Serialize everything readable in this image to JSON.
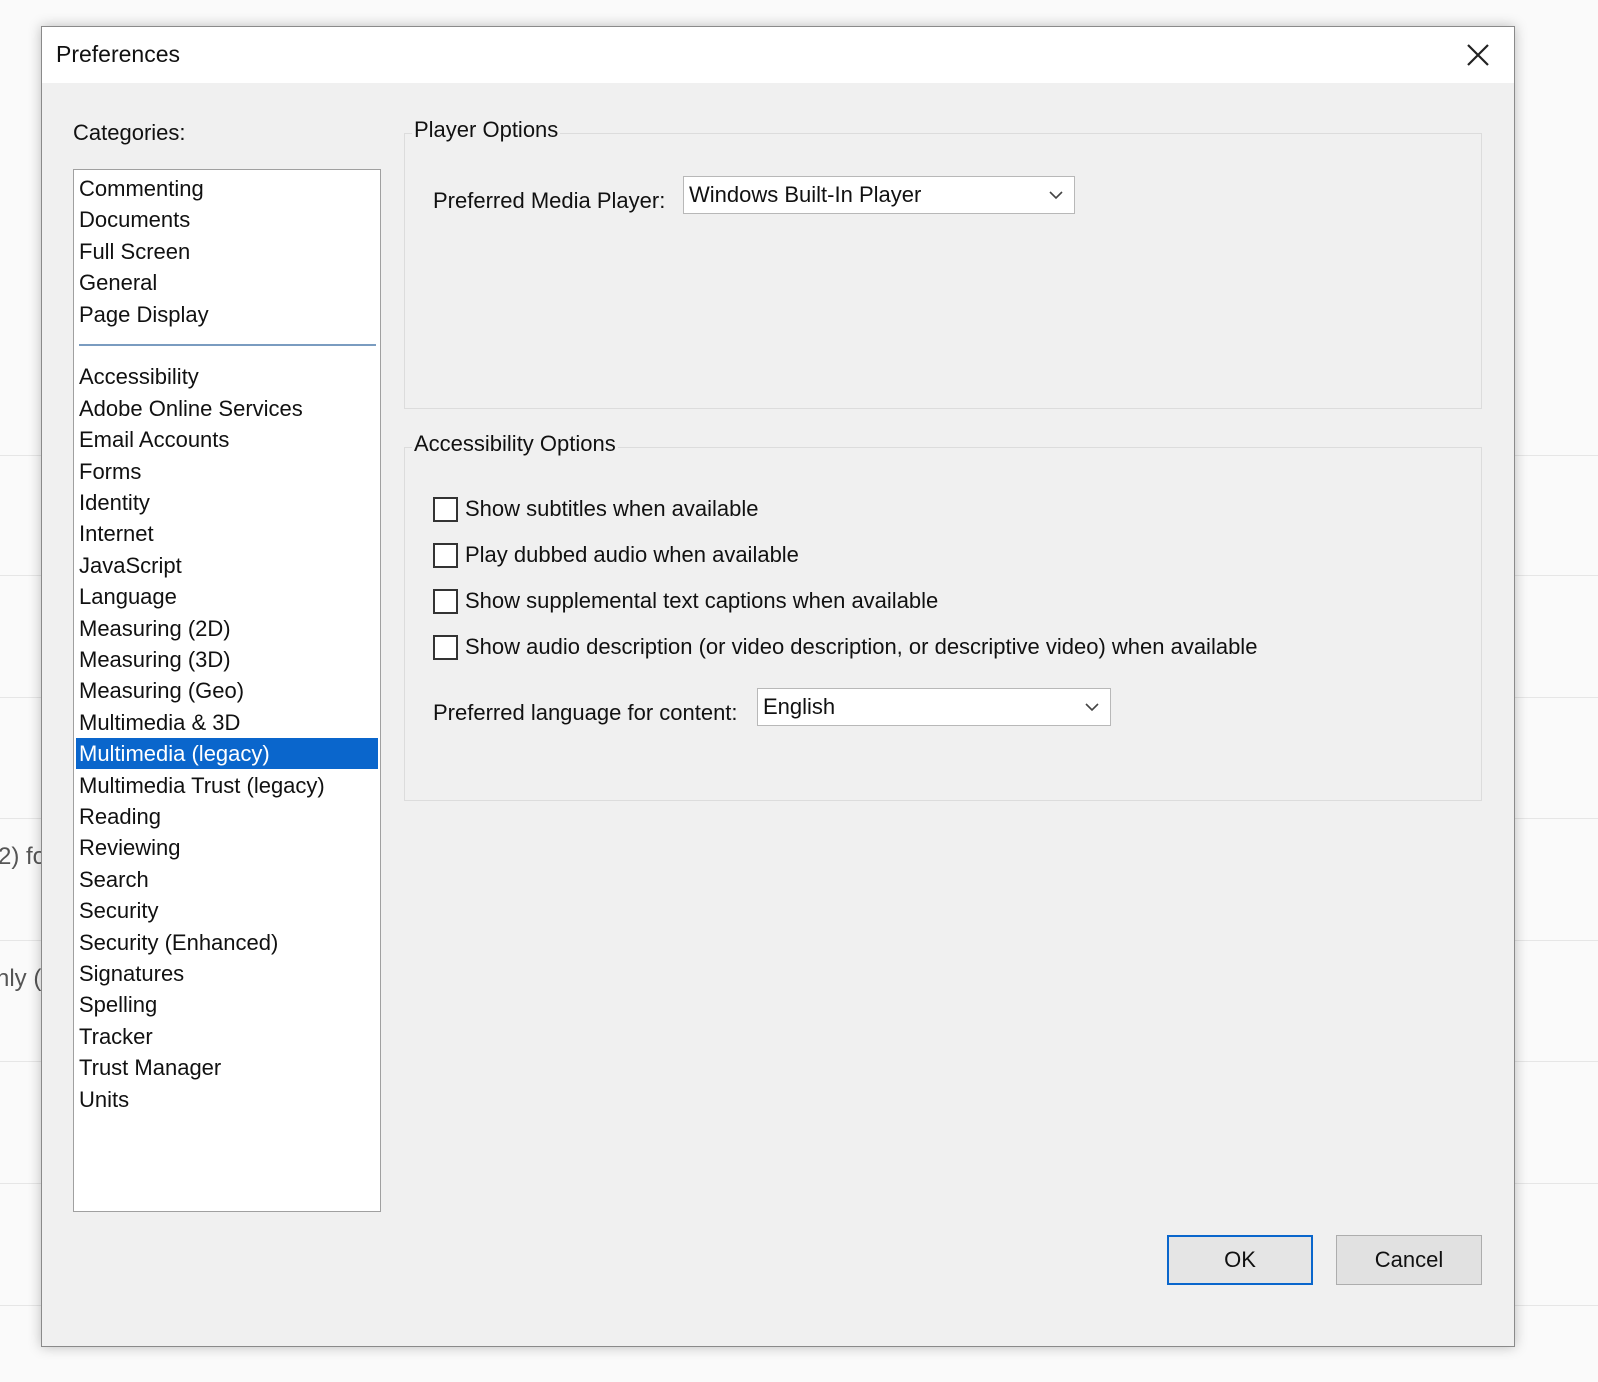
{
  "background": {
    "fragments": [
      "2) fo",
      "nly ("
    ]
  },
  "dialog": {
    "title": "Preferences",
    "close_icon": "close-icon"
  },
  "categories": {
    "label": "Categories:",
    "top_group": [
      "Commenting",
      "Documents",
      "Full Screen",
      "General",
      "Page Display"
    ],
    "bottom_group": [
      "Accessibility",
      "Adobe Online Services",
      "Email Accounts",
      "Forms",
      "Identity",
      "Internet",
      "JavaScript",
      "Language",
      "Measuring (2D)",
      "Measuring (3D)",
      "Measuring (Geo)",
      "Multimedia & 3D",
      "Multimedia (legacy)",
      "Multimedia Trust (legacy)",
      "Reading",
      "Reviewing",
      "Search",
      "Security",
      "Security (Enhanced)",
      "Signatures",
      "Spelling",
      "Tracker",
      "Trust Manager",
      "Units"
    ],
    "selected": "Multimedia (legacy)"
  },
  "player_options": {
    "title": "Player Options",
    "preferred_player_label": "Preferred Media Player:",
    "preferred_player_value": "Windows Built-In Player"
  },
  "accessibility_options": {
    "title": "Accessibility Options",
    "checkboxes": [
      {
        "label": "Show subtitles when available",
        "checked": false
      },
      {
        "label": "Play dubbed audio when available",
        "checked": false
      },
      {
        "label": "Show supplemental text captions when available",
        "checked": false
      },
      {
        "label": "Show audio description (or video description, or descriptive video) when available",
        "checked": false
      }
    ],
    "language_label": "Preferred language for content:",
    "language_value": "English"
  },
  "buttons": {
    "ok": "OK",
    "cancel": "Cancel"
  },
  "colors": {
    "selection": "#0a66cc",
    "dialog_bg": "#f0f0f0"
  }
}
